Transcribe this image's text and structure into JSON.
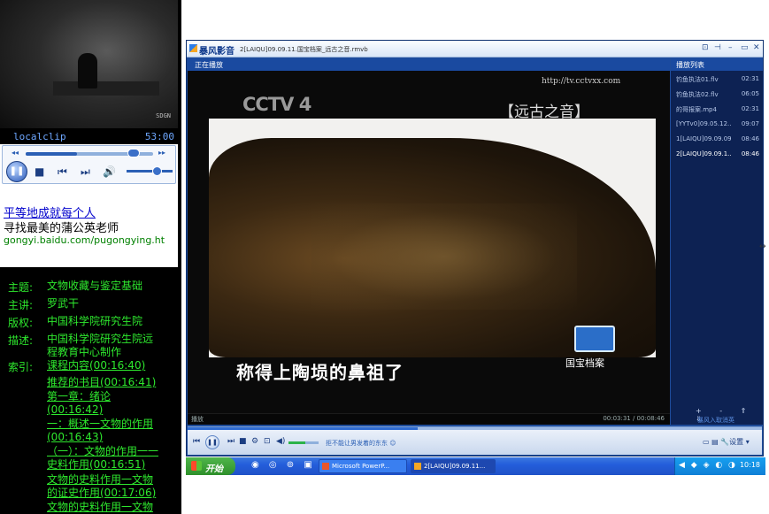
{
  "left": {
    "clip_name": "localclip",
    "clip_time": "53:00",
    "video_mark": "SDGN",
    "ad": {
      "link": "平等地成就每个人",
      "subtitle": "寻找最美的蒲公英老师",
      "url": "gongyi.baidu.com/pugongying.ht"
    },
    "info": {
      "subject_label": "主题:",
      "subject": "文物收藏与鉴定基础",
      "lecturer_label": "主讲:",
      "lecturer": "罗武干",
      "copyright_label": "版权:",
      "copyright": "中国科学院研究生院",
      "desc_label": "描述:",
      "desc": "中国科学院研究生院远程教育中心制作",
      "index_label": "索引:",
      "index": [
        "课程内容(00:16:40)",
        "推荐的书目(00:16:41)",
        "第一章：绪论(00:16:42)",
        "一：概述一文物的作用(00:16:43)",
        "（一）：文物的作用一一史料作用(00:16:51)",
        "文物的史料作用一文物的证史作用(00:17:06)",
        "文物的史料作用一文物"
      ]
    }
  },
  "player": {
    "app_name": "暴风影音",
    "file_title": "2[LAIQU]09.09.11.国宝档案_远古之音.rmvb",
    "tab_label": "正在播放",
    "playlist_title": "播放列表",
    "screen": {
      "channel": "CCTV 4",
      "url_overlay": "http://tv.cctvxx.com",
      "program_title": "【远古之音】",
      "subtitle": "称得上陶埙的鼻祖了",
      "badge_text": "国宝档案"
    },
    "playlist": [
      {
        "name": "钓鱼执法01.flv",
        "time": "02:31"
      },
      {
        "name": "钓鱼执法02.flv",
        "time": "06:05"
      },
      {
        "name": "的哥报案.mp4",
        "time": "02:31"
      },
      {
        "name": "[YYTv0]09.05.12...",
        "time": "09:07"
      },
      {
        "name": "1[LAIQU]09.09.09...",
        "time": "08:46"
      },
      {
        "name": "2[LAIQU]09.09.1...",
        "time": "08:46",
        "current": true
      }
    ],
    "playlist_buttons": "+ - ⇑ ⇓",
    "playlist_link": "暴风入取消英",
    "status_left": "播放",
    "status_time": "00:03:31 / 00:08:46",
    "progress_fraction": 0.4,
    "volume_fraction": 0.55,
    "control_message": "拒不能让男发着的东东 ☺",
    "right_buttons": "▭ ▤ 🔧设置 ▾",
    "titlebar_buttons": [
      "⊡",
      "⊣",
      "–",
      "▭",
      "✕"
    ]
  },
  "taskbar": {
    "start_label": "开始",
    "quick_launch": "◉ ◎ ⊚ ▣",
    "tasks": [
      {
        "label": "Microsoft PowerP..."
      },
      {
        "label": "2[LAIQU]09.09.11...",
        "active": true
      }
    ],
    "tray_icons": "◀ ◆ ◈ ◐ ◑",
    "clock": "10:18"
  }
}
